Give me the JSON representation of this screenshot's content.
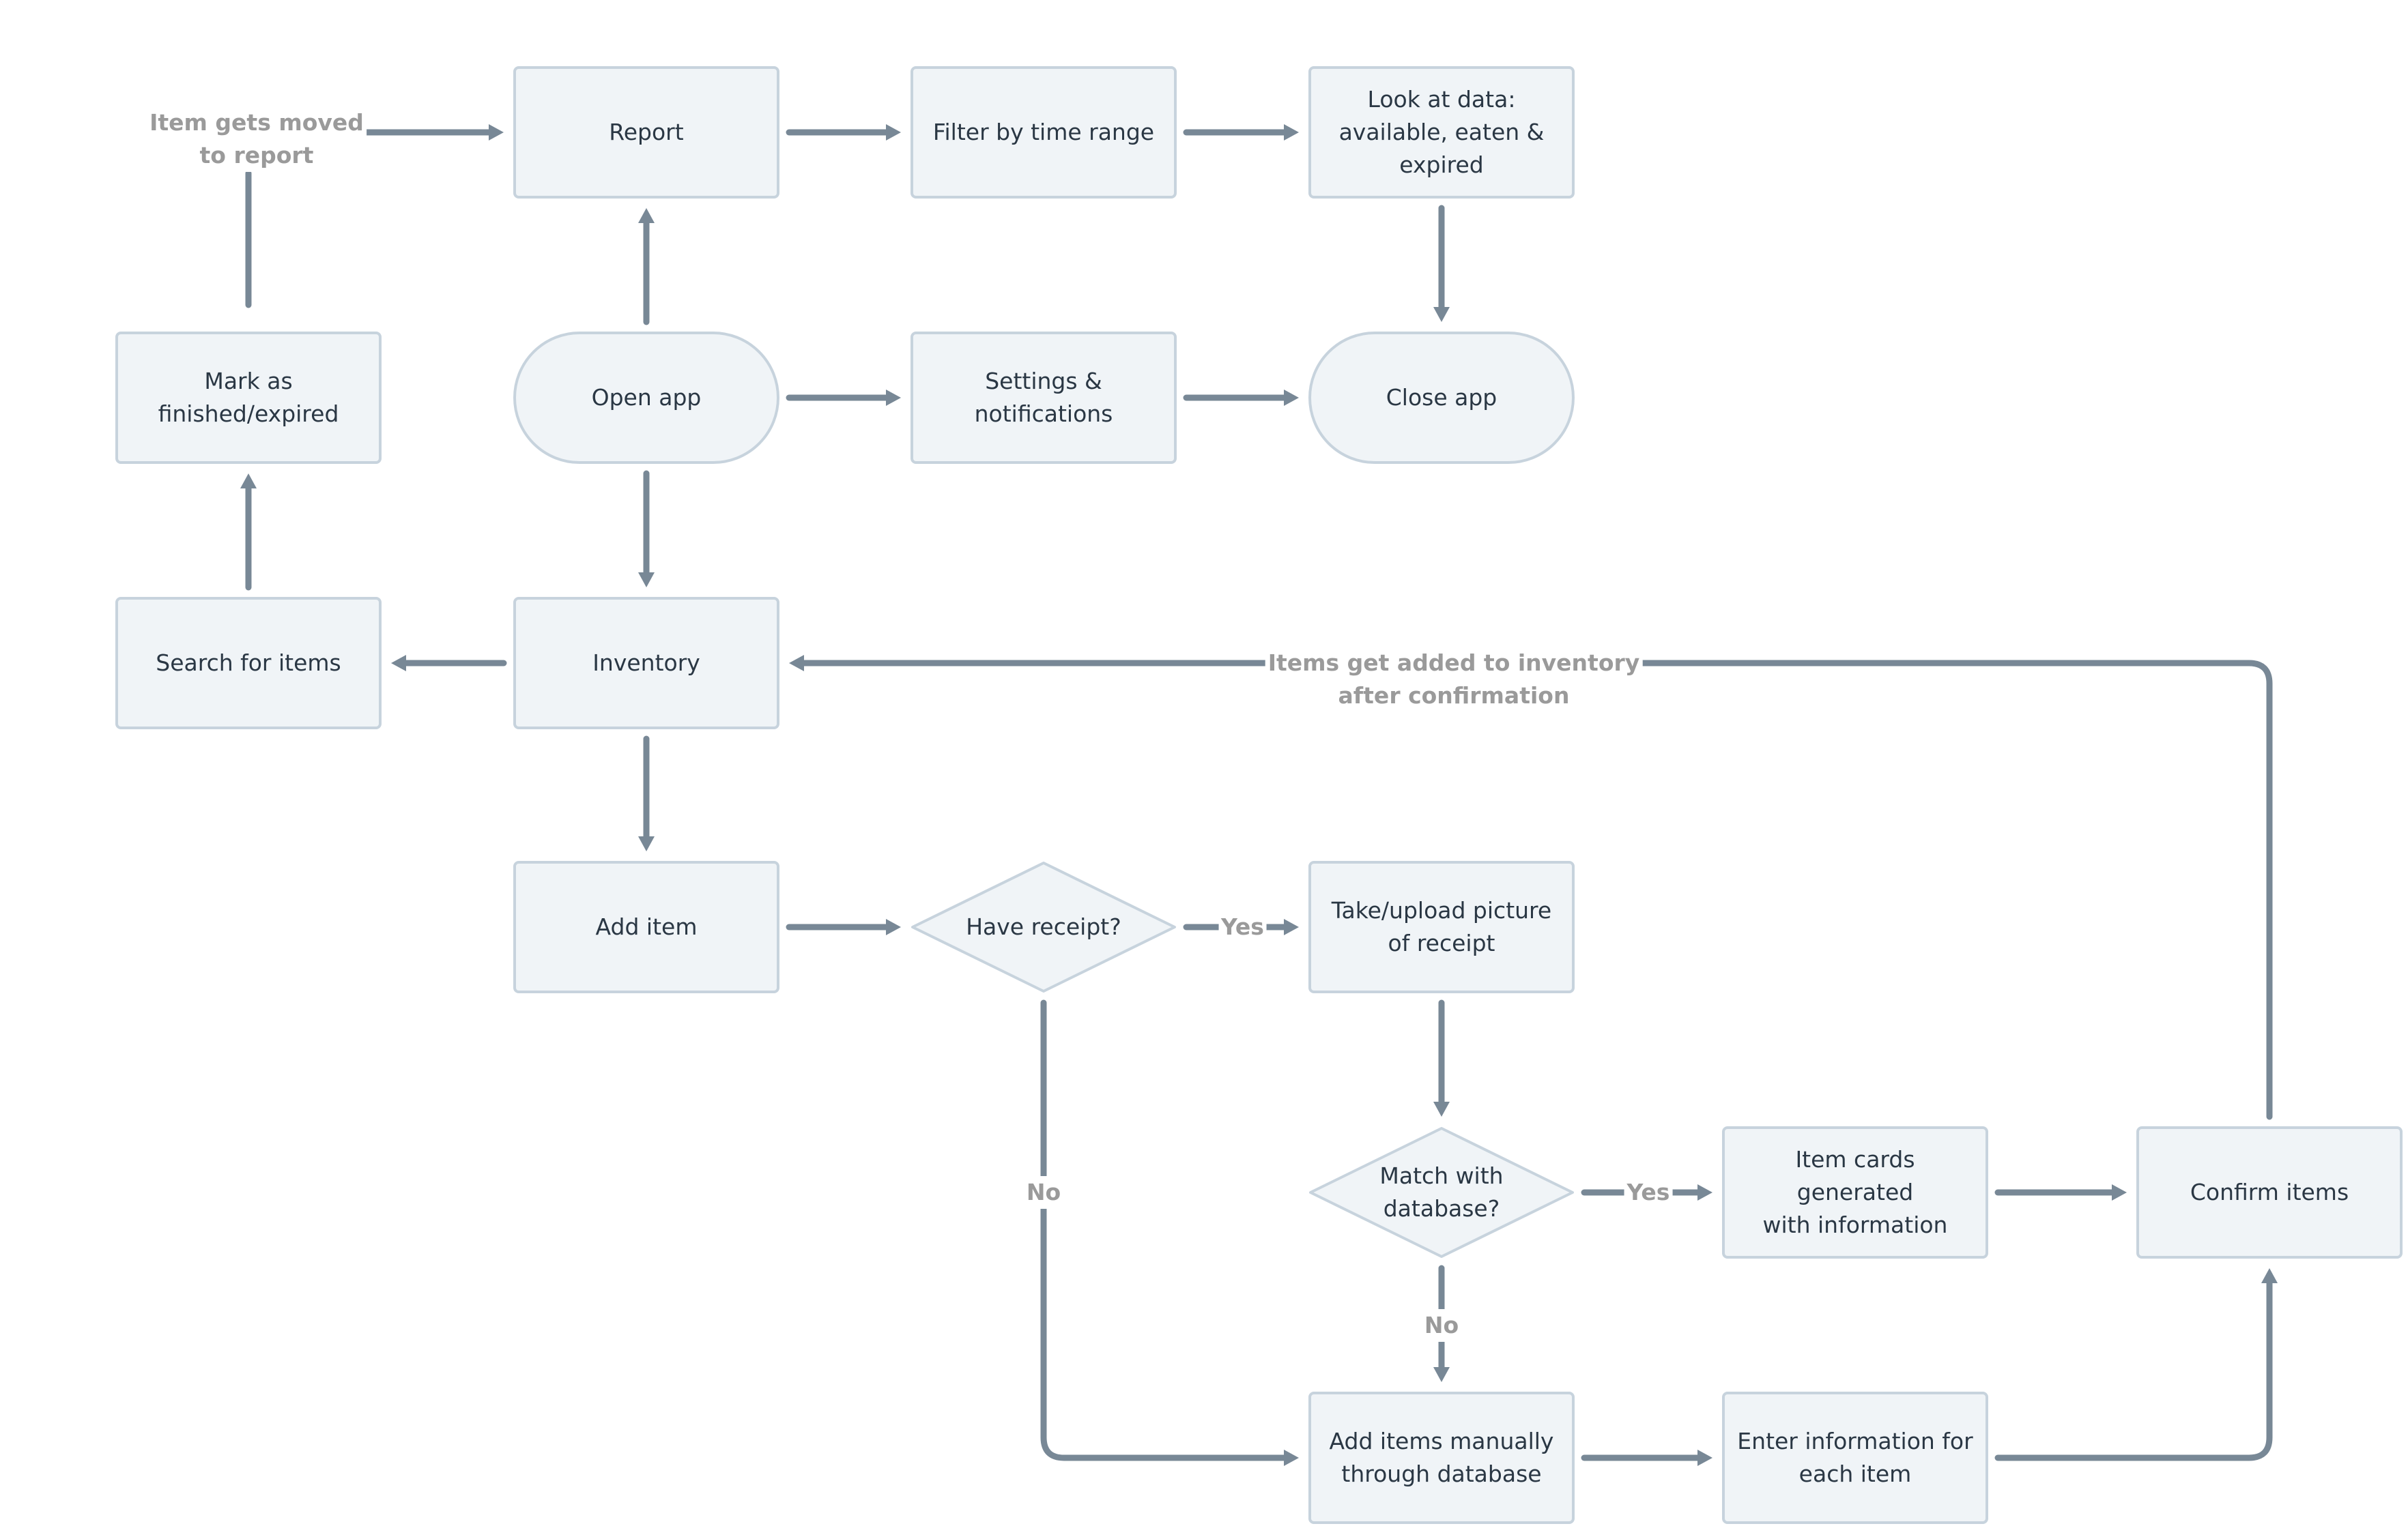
{
  "diagram": {
    "type": "flowchart",
    "colors": {
      "node_fill": "#F0F4F7",
      "node_border": "#C7D3DD",
      "node_text": "#2A3744",
      "edge": "#788896",
      "edge_label": "#9A9A9A"
    },
    "nodes": [
      {
        "id": "report",
        "label": "Report",
        "shape": "rect",
        "col": 1,
        "row": 0
      },
      {
        "id": "filter",
        "label": "Filter by time range",
        "shape": "rect",
        "col": 2,
        "row": 0
      },
      {
        "id": "lookdata",
        "label": "Look at data:\navailable, eaten &\nexpired",
        "shape": "rect",
        "col": 3,
        "row": 0
      },
      {
        "id": "mark",
        "label": "Mark as\nfinished/expired",
        "shape": "rect",
        "col": 0,
        "row": 1
      },
      {
        "id": "openapp",
        "label": "Open app",
        "shape": "pill",
        "col": 1,
        "row": 1
      },
      {
        "id": "settings",
        "label": "Settings &\nnotifications",
        "shape": "rect",
        "col": 2,
        "row": 1
      },
      {
        "id": "closeapp",
        "label": "Close app",
        "shape": "pill",
        "col": 3,
        "row": 1
      },
      {
        "id": "search",
        "label": "Search for items",
        "shape": "rect",
        "col": 0,
        "row": 2
      },
      {
        "id": "inventory",
        "label": "Inventory",
        "shape": "rect",
        "col": 1,
        "row": 2
      },
      {
        "id": "additem",
        "label": "Add item",
        "shape": "rect",
        "col": 1,
        "row": 3
      },
      {
        "id": "havereceipt",
        "label": "Have receipt?",
        "shape": "diamond",
        "col": 2,
        "row": 3
      },
      {
        "id": "takepicture",
        "label": "Take/upload picture\nof receipt",
        "shape": "rect",
        "col": 3,
        "row": 3
      },
      {
        "id": "matchdb",
        "label": "Match with\ndatabase?",
        "shape": "diamond",
        "col": 3,
        "row": 4
      },
      {
        "id": "itemcards",
        "label": "Item cards generated\nwith information",
        "shape": "rect",
        "col": 4,
        "row": 4
      },
      {
        "id": "confirm",
        "label": "Confirm items",
        "shape": "rect",
        "col": 5,
        "row": 4
      },
      {
        "id": "addmanual",
        "label": "Add items manually\nthrough database",
        "shape": "rect",
        "col": 3,
        "row": 5
      },
      {
        "id": "enterinfo",
        "label": "Enter information for\neach item",
        "shape": "rect",
        "col": 4,
        "row": 5
      }
    ],
    "edges": [
      {
        "from": "mark",
        "to": "report",
        "label": "Item gets moved\nto report"
      },
      {
        "from": "openapp",
        "to": "report",
        "label": ""
      },
      {
        "from": "report",
        "to": "filter",
        "label": ""
      },
      {
        "from": "filter",
        "to": "lookdata",
        "label": ""
      },
      {
        "from": "lookdata",
        "to": "closeapp",
        "label": ""
      },
      {
        "from": "openapp",
        "to": "settings",
        "label": ""
      },
      {
        "from": "settings",
        "to": "closeapp",
        "label": ""
      },
      {
        "from": "openapp",
        "to": "inventory",
        "label": ""
      },
      {
        "from": "search",
        "to": "mark",
        "label": ""
      },
      {
        "from": "inventory",
        "to": "search",
        "label": ""
      },
      {
        "from": "inventory",
        "to": "additem",
        "label": ""
      },
      {
        "from": "additem",
        "to": "havereceipt",
        "label": ""
      },
      {
        "from": "havereceipt",
        "to": "takepicture",
        "label": "Yes"
      },
      {
        "from": "havereceipt",
        "to": "addmanual",
        "label": "No"
      },
      {
        "from": "takepicture",
        "to": "matchdb",
        "label": ""
      },
      {
        "from": "matchdb",
        "to": "itemcards",
        "label": "Yes"
      },
      {
        "from": "matchdb",
        "to": "addmanual",
        "label": "No"
      },
      {
        "from": "itemcards",
        "to": "confirm",
        "label": ""
      },
      {
        "from": "addmanual",
        "to": "enterinfo",
        "label": ""
      },
      {
        "from": "enterinfo",
        "to": "confirm",
        "label": ""
      },
      {
        "from": "confirm",
        "to": "inventory",
        "label": "Items get added to inventory\nafter confirmation"
      }
    ]
  }
}
